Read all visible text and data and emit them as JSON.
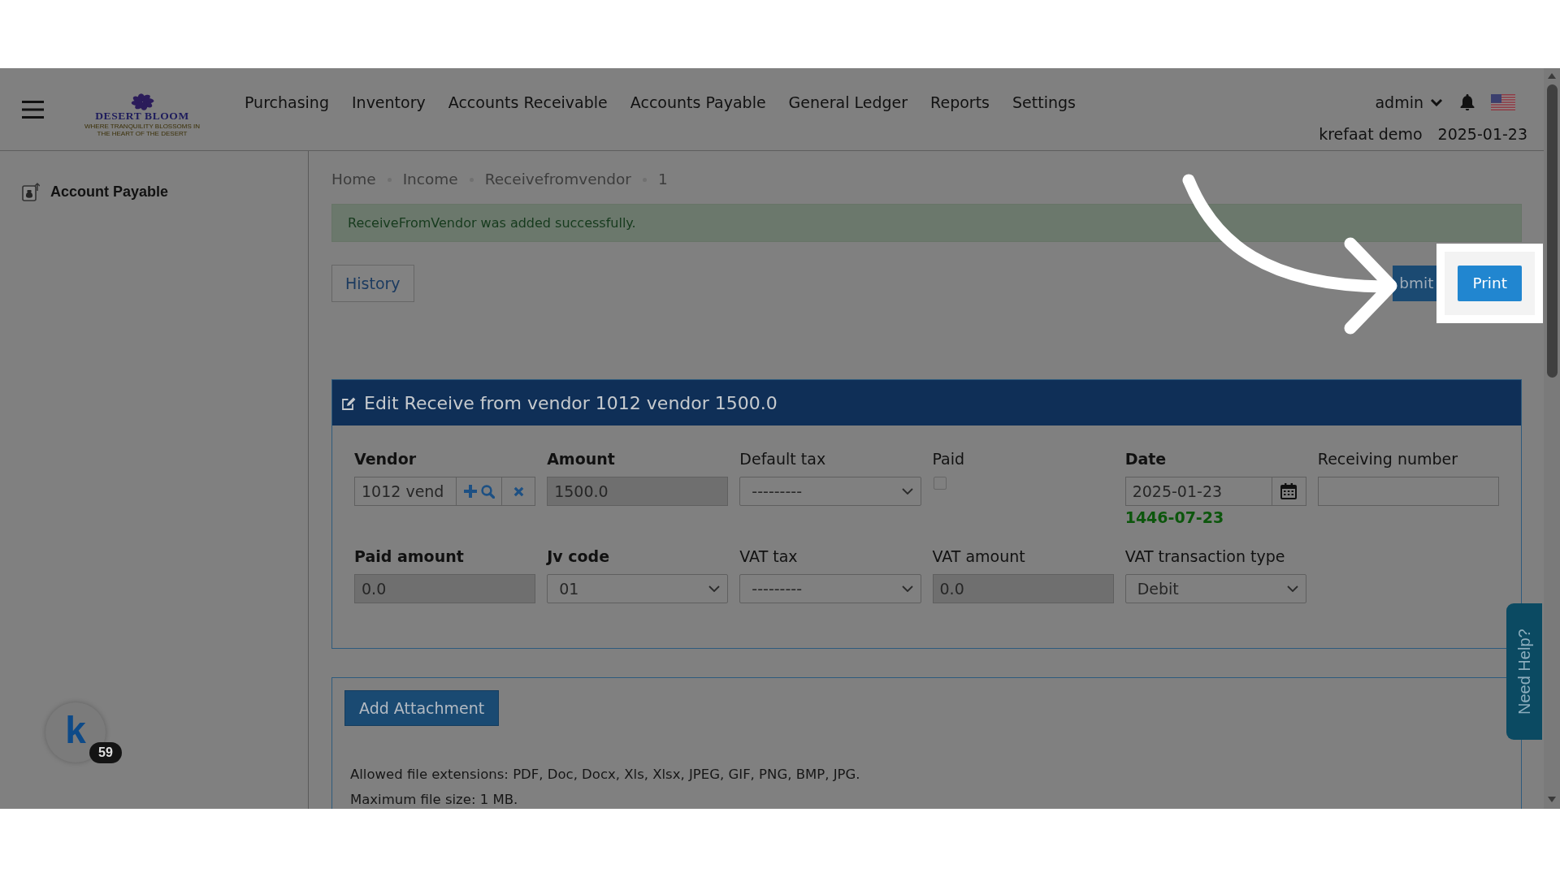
{
  "header": {
    "logo": {
      "name": "DESERT BLOOM",
      "tagline": "WHERE TRANQUILITY BLOSSOMS IN THE HEART OF THE DESERT"
    },
    "nav": [
      "Purchasing",
      "Inventory",
      "Accounts Receivable",
      "Accounts Payable",
      "General Ledger",
      "Reports",
      "Settings"
    ],
    "user": "admin",
    "company": "krefaat demo",
    "date": "2025-01-23"
  },
  "sidebar": {
    "items": [
      {
        "label": "Account Payable"
      }
    ]
  },
  "chat_widget": {
    "label": "k",
    "badge": "59"
  },
  "breadcrumb": [
    "Home",
    "Income",
    "Receivefromvendor",
    "1"
  ],
  "alert": {
    "kind": "success",
    "text": "ReceiveFromVendor was added successfully."
  },
  "actions": [
    {
      "label": "History",
      "kind": "outline",
      "highlighted": false
    },
    {
      "label": "bmit",
      "kind": "solid",
      "highlighted": false
    },
    {
      "label": "Print",
      "kind": "solid",
      "highlighted": true
    }
  ],
  "form": {
    "title": "Edit Receive from vendor 1012 vendor 1500.0",
    "rows": [
      [
        {
          "label": "Vendor",
          "required": true,
          "kind": "lookup",
          "value": "1012 vend",
          "readonly": false
        },
        {
          "label": "Amount",
          "required": true,
          "kind": "input",
          "value": "1500.0",
          "readonly": true
        },
        {
          "label": "Default tax",
          "required": false,
          "kind": "select",
          "value": "---------",
          "readonly": false
        },
        {
          "label": "Paid",
          "required": false,
          "kind": "checkbox",
          "checked": false,
          "readonly": false
        },
        {
          "label": "Date",
          "required": true,
          "kind": "date",
          "value": "2025-01-23",
          "secondary_date": "1446-07-23",
          "readonly": false
        },
        {
          "label": "Receiving number",
          "required": false,
          "kind": "input",
          "readonly": false
        }
      ],
      [
        {
          "label": "Paid amount",
          "required": true,
          "kind": "input",
          "value": "0.0",
          "readonly": true
        },
        {
          "label": "Jv code",
          "required": true,
          "kind": "select",
          "value": "01",
          "readonly": false
        },
        {
          "label": "VAT tax",
          "required": false,
          "kind": "select",
          "value": "---------",
          "readonly": false
        },
        {
          "label": "VAT amount",
          "required": false,
          "kind": "input",
          "value": "0.0",
          "readonly": true
        },
        {
          "label": "VAT transaction type",
          "required": false,
          "kind": "select",
          "value": "Debit",
          "readonly": false
        }
      ]
    ]
  },
  "attachments": {
    "button": "Add Attachment",
    "notes": [
      "Allowed file extensions: PDF, Doc, Docx, Xls, Xlsx, JPEG, GIF, PNG, BMP, JPG.",
      "Maximum file size: 1 MB."
    ]
  },
  "help_tab": {
    "label": "Need Help?"
  }
}
